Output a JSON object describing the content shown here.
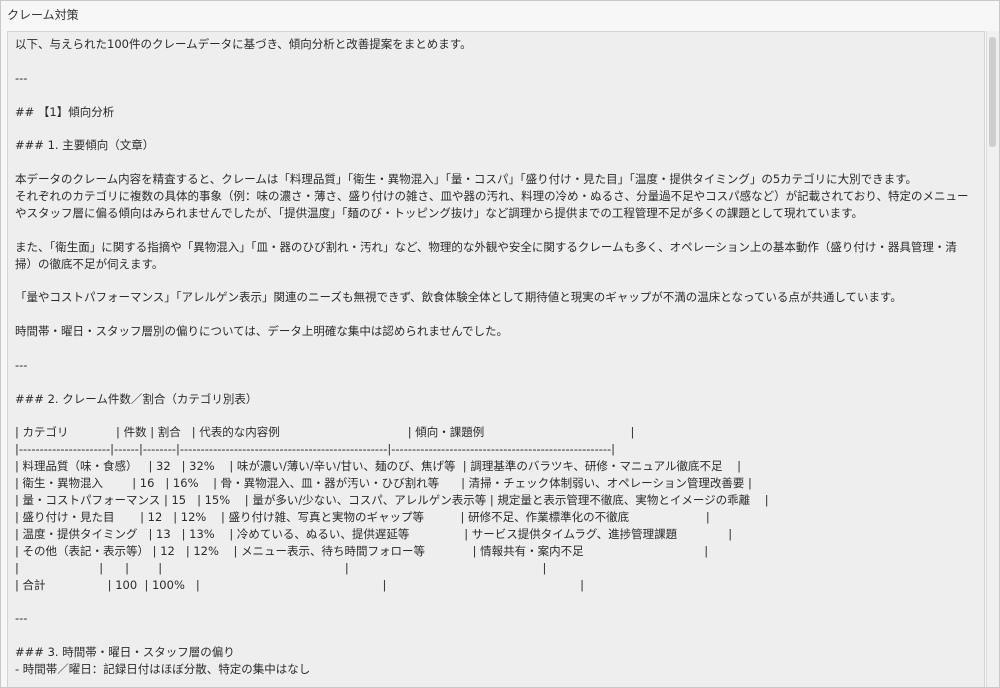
{
  "window": {
    "title": "クレーム対策"
  },
  "content": {
    "lines": [
      "以下、与えられた100件のクレームデータに基づき、傾向分析と改善提案をまとめます。",
      "",
      "---",
      "",
      "## 【1】傾向分析",
      "",
      "### 1. 主要傾向（文章）",
      "",
      "本データのクレーム内容を精査すると、クレームは「料理品質」「衛生・異物混入」「量・コスパ」「盛り付け・見た目」「温度・提供タイミング」の5カテゴリに大別できます。",
      "それぞれのカテゴリに複数の具体的事象（例：味の濃さ・薄さ、盛り付けの雑さ、皿や器の汚れ、料理の冷め・ぬるさ、分量過不足やコスパ感など）が記載されており、特定のメニュー",
      "やスタッフ層に偏る傾向はみられませんでしたが、「提供温度」「麺のび・トッピング抜け」など調理から提供までの工程管理不足が多くの課題として現れています。",
      "",
      "また、「衛生面」に関する指摘や「異物混入」「皿・器のひび割れ・汚れ」など、物理的な外観や安全に関するクレームも多く、オペレーション上の基本動作（盛り付け・器具管理・清",
      "掃）の徹底不足が伺えます。",
      "",
      "「量やコストパフォーマンス」「アレルゲン表示」関連のニーズも無視できず、飲食体験全体として期待値と現実のギャップが不満の温床となっている点が共通しています。",
      "",
      "時間帯・曜日・スタッフ層別の偏りについては、データ上明確な集中は認められませんでした。",
      "",
      "---",
      "",
      "### 2. クレーム件数／割合（カテゴリ別表）",
      "",
      "| カテゴリ             | 件数 | 割合   | 代表的な内容例                                   | 傾向・課題例                                        |",
      "|----------------------|------|--------|--------------------------------------------------|-----------------------------------------------------|",
      "| 料理品質（味・食感）   | 32   | 32%    | 味が濃い/薄い/辛い/甘い、麺のび、焦げ等  | 調理基準のバラツキ、研修・マニュアル徹底不足    |",
      "| 衛生・異物混入        | 16   | 16%    | 骨・異物混入、皿・器が汚い・ひび割れ等      | 清掃・チェック体制弱い、オペレーション管理改善要 |",
      "| 量・コストパフォーマンス | 15   | 15%    | 量が多い/少ない、コスパ、アレルゲン表示等 | 規定量と表示管理不徹底、実物とイメージの乖離    |",
      "| 盛り付け・見た目       | 12   | 12%    | 盛り付け雑、写真と実物のギャップ等          | 研修不足、作業標準化の不徹底                     |",
      "| 温度・提供タイミング   | 13   | 13%    | 冷めている、ぬるい、提供遅延等               | サービス提供タイムラグ、進捗管理課題              |",
      "| その他（表記・表示等） | 12   | 12%    | メニュー表示、待ち時間フォロー等             | 情報共有・案内不足                                 |",
      "|                      |      |        |                                                  |                                                     |",
      "| 合計                 | 100  | 100%   |                                                  |                                                     |",
      "",
      "---",
      "",
      "### 3. 時間帯・曜日・スタッフ層の偏り",
      "- 時間帯／曜日：記録日付はほぼ分散、特定の集中はなし"
    ]
  }
}
